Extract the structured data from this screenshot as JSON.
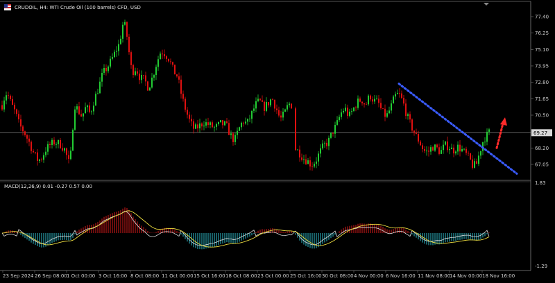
{
  "header": {
    "title": "CRUDOIL, H4:  WTI Crude Oil (100 barrels) CFD, USD"
  },
  "macd": {
    "label": "MACD(12,26,9) 0.01 -0.27 0.57 0.00"
  },
  "colors": {
    "bull": "#22cc33",
    "bear": "#e01010",
    "macd_pos": "#c01818",
    "macd_neg": "#2aa9b5",
    "signal": "#f0e040",
    "macd_line": "#e0e0e0",
    "trendline": "#3a5cff",
    "arrow": "#ff2a2a",
    "price_line": "#9a9a9a"
  },
  "chart_data": {
    "type": "candlestick",
    "current_price": "69.27",
    "price_ticks": [
      "77.40",
      "76.25",
      "75.10",
      "73.95",
      "72.80",
      "71.65",
      "70.50",
      "69.27",
      "68.20",
      "67.05"
    ],
    "macd_ticks": [
      "1.83",
      "-1.29"
    ],
    "x_ticks": [
      "23 Sep 2024",
      "26 Sep 08:00",
      "1 Oct 00:00",
      "3 Oct 16:00",
      "8 Oct 08:00",
      "11 Oct 00:00",
      "15 Oct 16:00",
      "18 Oct 08:00",
      "23 Oct 00:00",
      "25 Oct 16:00",
      "30 Oct 08:00",
      "4 Nov 00:00",
      "6 Nov 16:00",
      "11 Nov 08:00",
      "14 Nov 00:00",
      "18 Nov 16:00"
    ],
    "trendline": {
      "from": {
        "date": "6 Nov 16:00",
        "price": 72.7
      },
      "to": {
        "date": "20 Nov",
        "price": 66.4
      }
    },
    "arrow": {
      "from_price": 68.2,
      "to_price": 70.2
    }
  }
}
